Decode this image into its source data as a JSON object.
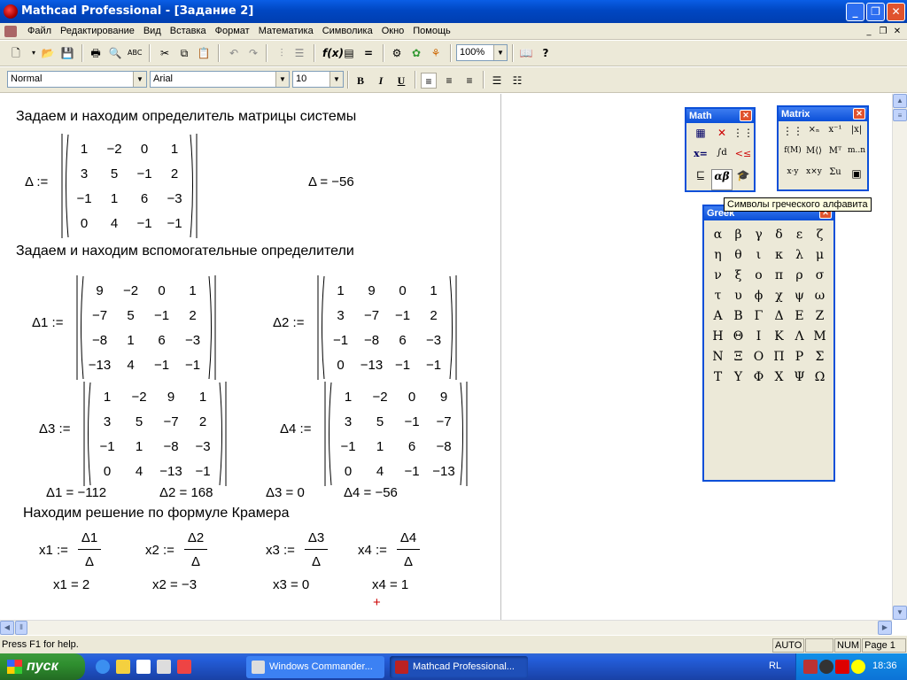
{
  "window": {
    "title": "Mathcad Professional - [Задание 2]",
    "min": "_",
    "max": "❐",
    "close": "✕"
  },
  "menu": [
    "Файл",
    "Редактирование",
    "Вид",
    "Вставка",
    "Формат",
    "Математика",
    "Символика",
    "Окно",
    "Помощь"
  ],
  "toolbar": {
    "zoom": "100%"
  },
  "format": {
    "style": "Normal",
    "font": "Arial",
    "size": "10",
    "bold": "B",
    "italic": "I",
    "underline": "U"
  },
  "doc": {
    "h1": "Задаем и находим определитель матрицы системы",
    "delta_lbl": "Δ :=",
    "delta_res": "Δ = −56",
    "matrix_main": [
      [
        "1",
        "−2",
        "0",
        "1"
      ],
      [
        "3",
        "5",
        "−1",
        "2"
      ],
      [
        "−1",
        "1",
        "6",
        "−3"
      ],
      [
        "0",
        "4",
        "−1",
        "−1"
      ]
    ],
    "h2": "Задаем и находим вспомогательные определители",
    "d1_lbl": "Δ1 :=",
    "matrix_d1": [
      [
        "9",
        "−2",
        "0",
        "1"
      ],
      [
        "−7",
        "5",
        "−1",
        "2"
      ],
      [
        "−8",
        "1",
        "6",
        "−3"
      ],
      [
        "−13",
        "4",
        "−1",
        "−1"
      ]
    ],
    "d2_lbl": "Δ2 :=",
    "matrix_d2": [
      [
        "1",
        "9",
        "0",
        "1"
      ],
      [
        "3",
        "−7",
        "−1",
        "2"
      ],
      [
        "−1",
        "−8",
        "6",
        "−3"
      ],
      [
        "0",
        "−13",
        "−1",
        "−1"
      ]
    ],
    "d3_lbl": "Δ3 :=",
    "matrix_d3": [
      [
        "1",
        "−2",
        "9",
        "1"
      ],
      [
        "3",
        "5",
        "−7",
        "2"
      ],
      [
        "−1",
        "1",
        "−8",
        "−3"
      ],
      [
        "0",
        "4",
        "−13",
        "−1"
      ]
    ],
    "d4_lbl": "Δ4 :=",
    "matrix_d4": [
      [
        "1",
        "−2",
        "0",
        "9"
      ],
      [
        "3",
        "5",
        "−1",
        "−7"
      ],
      [
        "−1",
        "1",
        "6",
        "−8"
      ],
      [
        "0",
        "4",
        "−1",
        "−13"
      ]
    ],
    "results": [
      "Δ1 = −112",
      "Δ2 = 168",
      "Δ3 = 0",
      "Δ4 = −56"
    ],
    "h3": "Находим решение по формуле Крамера",
    "x_defs": [
      {
        "lbl": "x1 :=",
        "num": "Δ1",
        "den": "Δ"
      },
      {
        "lbl": "x2 :=",
        "num": "Δ2",
        "den": "Δ"
      },
      {
        "lbl": "x3 :=",
        "num": "Δ3",
        "den": "Δ"
      },
      {
        "lbl": "x4 :=",
        "num": "Δ4",
        "den": "Δ"
      }
    ],
    "x_results": [
      "x1 = 2",
      "x2 = −3",
      "x3 = 0",
      "x4 = 1"
    ],
    "cursor": "+"
  },
  "palettes": {
    "math_title": "Math",
    "matrix_title": "Matrix",
    "greek_title": "Greek",
    "tooltip": "Символы греческого алфавита",
    "greek": [
      "α",
      "β",
      "γ",
      "δ",
      "ε",
      "ζ",
      "η",
      "θ",
      "ι",
      "κ",
      "λ",
      "μ",
      "ν",
      "ξ",
      "ο",
      "π",
      "ρ",
      "σ",
      "τ",
      "υ",
      "ϕ",
      "χ",
      "ψ",
      "ω",
      "Α",
      "Β",
      "Γ",
      "Δ",
      "Ε",
      "Ζ",
      "Η",
      "Θ",
      "Ι",
      "Κ",
      "Λ",
      "Μ",
      "Ν",
      "Ξ",
      "Ο",
      "Π",
      "Ρ",
      "Σ",
      "Τ",
      "Υ",
      "Φ",
      "Χ",
      "Ψ",
      "Ω"
    ]
  },
  "status": {
    "help": "Press F1 for help.",
    "auto": "AUTO",
    "num": "NUM",
    "page": "Page 1"
  },
  "taskbar": {
    "start": "пуск",
    "task1": "Windows Commander...",
    "task2": "Mathcad Professional...",
    "lang": "RL",
    "time": "18:36"
  }
}
